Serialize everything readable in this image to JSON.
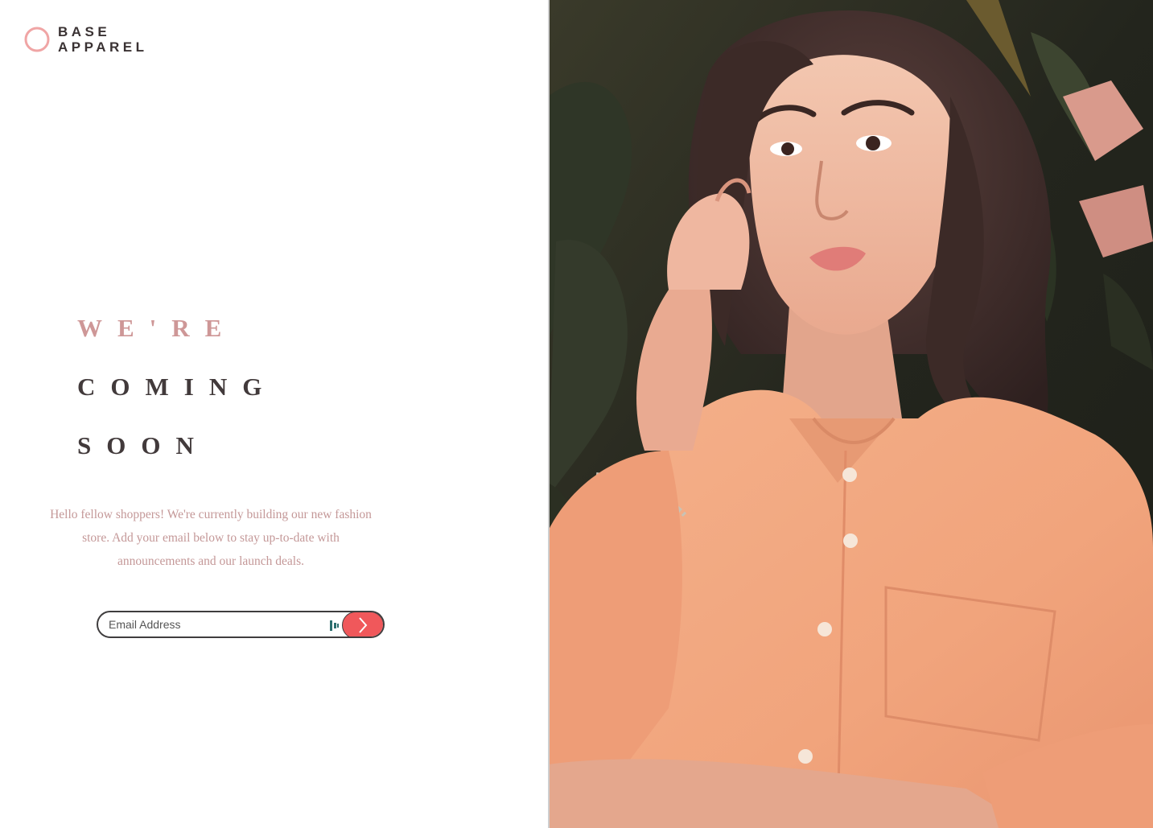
{
  "brand": {
    "line1": "BASE",
    "line2": "APPAREL",
    "accent_color": "#f0a5a5"
  },
  "headline": {
    "line1": "WE'RE",
    "line2": "COMING",
    "line3": "SOON"
  },
  "intro": {
    "text": "Hello fellow shoppers! We're currently building our new fashion store. Add your email below to stay up-to-date with announcements and our launch deals."
  },
  "signup": {
    "placeholder": "Email Address",
    "submit_icon": "chevron-right-icon",
    "submit_color": "#f0585b"
  },
  "hero": {
    "image": "woman in peach shirt against tropical leaves"
  }
}
